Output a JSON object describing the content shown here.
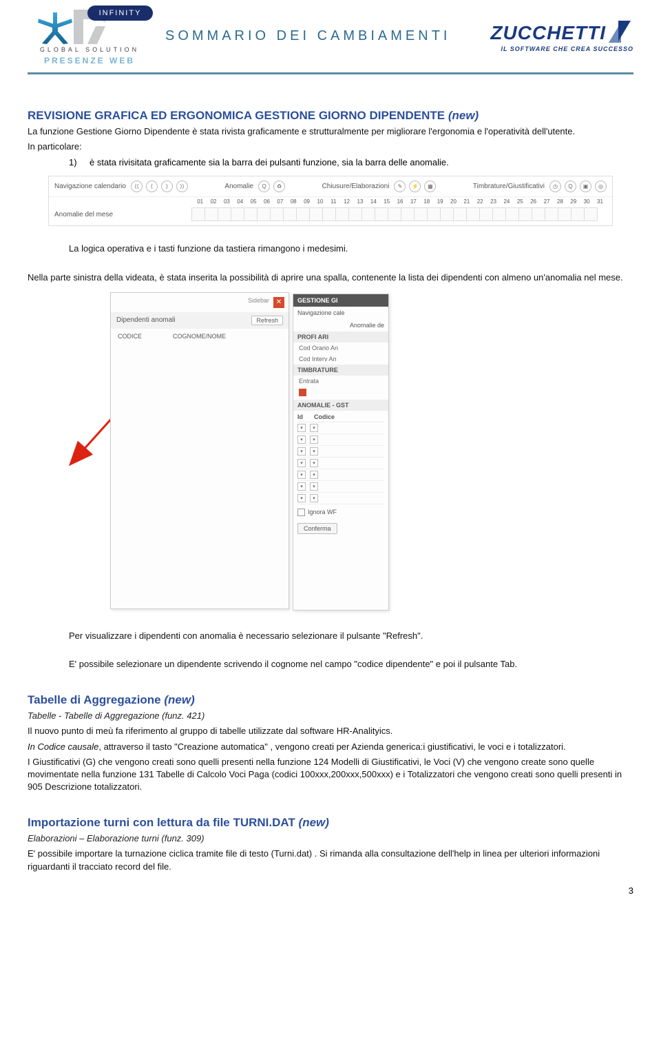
{
  "header": {
    "hr_infinity": "INFINITY",
    "hr_sub1": "GLOBAL SOLUTION",
    "hr_sub2": "PRESENZE WEB",
    "title": "SOMMARIO DEI CAMBIAMENTI",
    "zucchetti": "ZUCCHETTI",
    "zucchetti_tag": "IL SOFTWARE CHE CREA SUCCESSO"
  },
  "s1": {
    "title": "REVISIONE GRAFICA ED ERGONOMICA GESTIONE GIORNO DIPENDENTE",
    "new": "(new)",
    "p1": "La funzione Gestione Giorno Dipendente è stata rivista graficamente e strutturalmente per migliorare l'ergonomia e l'operatività dell'utente.",
    "p2": "In particolare:",
    "li1_n": "1)",
    "li1": "è stata rivisitata graficamente sia la barra dei pulsanti funzione, sia la barra delle anomalie.",
    "p3": "La logica operativa e i tasti funzione da tastiera rimangono i medesimi.",
    "p4": "Nella parte sinistra della videata, è stata inserita la possibilità di aprire una spalla, contenente la lista dei dipendenti con almeno un'anomalia nel mese.",
    "p5": "Per visualizzare i dipendenti con anomalia è necessario selezionare il pulsante \"Refresh\".",
    "p6": "E' possibile selezionare un dipendente scrivendo il cognome nel campo \"codice dipendente\" e poi il pulsante Tab."
  },
  "toolbar": {
    "nav": "Navigazione calendario",
    "anom": "Anomalie",
    "chius": "Chiusure/Elaborazioni",
    "timb": "Timbrature/Giustificativi",
    "row_label": "Anomalie del mese",
    "days": [
      "01",
      "02",
      "03",
      "04",
      "05",
      "06",
      "07",
      "08",
      "09",
      "10",
      "11",
      "12",
      "13",
      "14",
      "15",
      "16",
      "17",
      "18",
      "19",
      "20",
      "21",
      "22",
      "23",
      "24",
      "25",
      "26",
      "27",
      "28",
      "29",
      "30",
      "31"
    ]
  },
  "sidepanel": {
    "sidebar_label": "Sidebar",
    "dip_anom": "Dipendenti anomali",
    "refresh": "Refresh",
    "col1": "CODICE",
    "col2": "COGNOME/NOME",
    "right_hdr": "GESTIONE GI",
    "nav_cale": "Navigazione cale",
    "anom_de": "Anomalie de",
    "profi": "PROFI       ARI",
    "cod_orario": "Cod Orario An",
    "cod_interv": "Cod Interv An",
    "timbrature": "TIMBRATURE",
    "entrata": "Entrata",
    "anom_gst": "ANOMALIE - GST",
    "id": "Id",
    "codice": "Codice",
    "ignora": "Ignora WF",
    "conferma": "Conferma"
  },
  "s2": {
    "title": "Tabelle di Aggregazione",
    "new": "(new)",
    "sub": "Tabelle  - Tabelle di Aggregazione (funz. 421)",
    "p1": "Il nuovo punto di meù fa riferimento al gruppo di tabelle utilizzate  dal software HR-Analityics.",
    "p2": "In Codice causale, attraverso il tasto \"Creazione  automatica\" , vengono creati per Azienda generica:i giustificativi, le voci e i totalizzatori.",
    "p3": "I Giustificativi (G) che vengono creati sono quelli presenti nella funzione 124 Modelli di Giustificativi, le Voci (V) che vengono create sono quelle movimentate nella funzione 131 Tabelle di Calcolo Voci Paga (codici 100xxx,200xxx,500xxx) e i Totalizzatori che vengono creati sono quelli presenti in 905 Descrizione totalizzatori."
  },
  "s3": {
    "title": "Importazione turni con lettura da file TURNI.DAT",
    "new": "(new)",
    "sub": "Elaborazioni – Elaborazione turni (funz. 309)",
    "p1": "E' possibile importare la turnazione ciclica tramite file di testo (Turni.dat) . Si rimanda alla consultazione dell'help in linea per ulteriori informazioni riguardanti il tracciato record del file."
  },
  "page_num": "3"
}
